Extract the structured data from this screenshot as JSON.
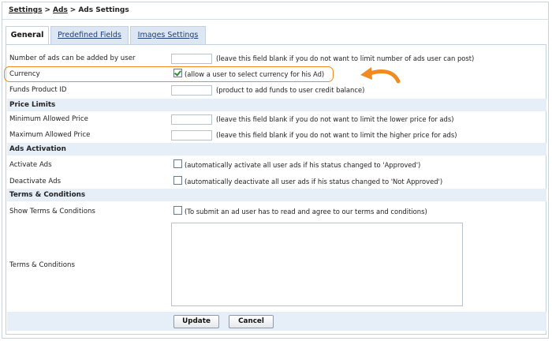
{
  "breadcrumb": {
    "items": [
      "Settings",
      "Ads"
    ],
    "current": "Ads Settings",
    "separator": ">"
  },
  "tabs": [
    {
      "label": "General",
      "active": true
    },
    {
      "label": "Predefined Fields",
      "active": false
    },
    {
      "label": "Images Settings",
      "active": false
    }
  ],
  "fields": {
    "max_ads": {
      "label": "Number of ads can be added by user",
      "value": "",
      "hint": "(leave this field blank if you do not want to limit number of ads user can post)"
    },
    "currency": {
      "label": "Currency",
      "checked": true,
      "hint": "(allow a user to select currency for his Ad)"
    },
    "funds_product": {
      "label": "Funds Product ID",
      "value": "",
      "hint": "(product to add funds to user credit balance)"
    }
  },
  "sections": {
    "price_limits": "Price Limits",
    "ads_activation": "Ads Activation",
    "terms": "Terms & Conditions"
  },
  "price_limits": {
    "min": {
      "label": "Minimum Allowed Price",
      "value": "",
      "hint": "(leave this field blank if you do not want to limit the lower price for ads)"
    },
    "max": {
      "label": "Maximum Allowed Price",
      "value": "",
      "hint": "(leave this field blank if you do not want to limit the higher price for ads)"
    }
  },
  "activation": {
    "activate": {
      "label": "Activate Ads",
      "checked": false,
      "hint": "(automatically activate all user ads if his status changed to 'Approved')"
    },
    "deactivate": {
      "label": "Deactivate Ads",
      "checked": false,
      "hint": "(automatically deactivate all user ads if his status changed to 'Not Approved')"
    }
  },
  "terms": {
    "show": {
      "label": "Show Terms & Conditions",
      "checked": false,
      "hint": "(To submit an ad user has to read and agree to our terms and conditions)"
    },
    "text": {
      "label": "Terms & Conditions",
      "value": ""
    }
  },
  "buttons": {
    "update": "Update",
    "cancel": "Cancel"
  },
  "colors": {
    "highlight": "#f08a22",
    "section_bg": "#e6eef8",
    "tab_bg": "#dde7f3",
    "check": "#2f8d2f"
  },
  "icons": {
    "annotation": "curved-arrow-icon"
  }
}
